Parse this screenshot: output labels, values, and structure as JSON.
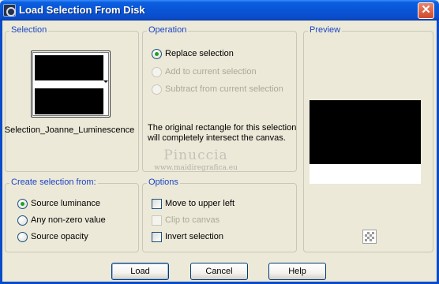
{
  "window": {
    "title": "Load Selection From Disk",
    "close_glyph": "✕"
  },
  "selection": {
    "legend": "Selection",
    "name": "Selection_Joanne_Luminescence"
  },
  "operation": {
    "legend": "Operation",
    "options": [
      {
        "label": "Replace selection",
        "checked": true,
        "disabled": false
      },
      {
        "label": "Add to current selection",
        "checked": false,
        "disabled": true
      },
      {
        "label": "Subtract from current selection",
        "checked": false,
        "disabled": true
      }
    ],
    "info_line1": "The original rectangle for this selection",
    "info_line2": "will completely intersect the canvas.",
    "watermark_line1": "Pinuccia",
    "watermark_line2": "www.maidiregrafica.eu"
  },
  "preview": {
    "legend": "Preview",
    "transparency_icon": "checkerboard-icon"
  },
  "create_from": {
    "legend": "Create selection from:",
    "options": [
      {
        "label": "Source luminance",
        "checked": true
      },
      {
        "label": "Any non-zero value",
        "checked": false
      },
      {
        "label": "Source opacity",
        "checked": false
      }
    ]
  },
  "options": {
    "legend": "Options",
    "items": [
      {
        "label": "Move to upper left",
        "checked": false,
        "disabled": false
      },
      {
        "label": "Clip to canvas",
        "checked": false,
        "disabled": true
      },
      {
        "label": "Invert selection",
        "checked": false,
        "disabled": false
      }
    ]
  },
  "buttons": {
    "load": "Load",
    "cancel": "Cancel",
    "help": "Help"
  },
  "colors": {
    "titlebar": "#0a55d6",
    "legend": "#1a44c4",
    "dialog_bg": "#ece9d8",
    "radio_dot": "#21a121"
  }
}
